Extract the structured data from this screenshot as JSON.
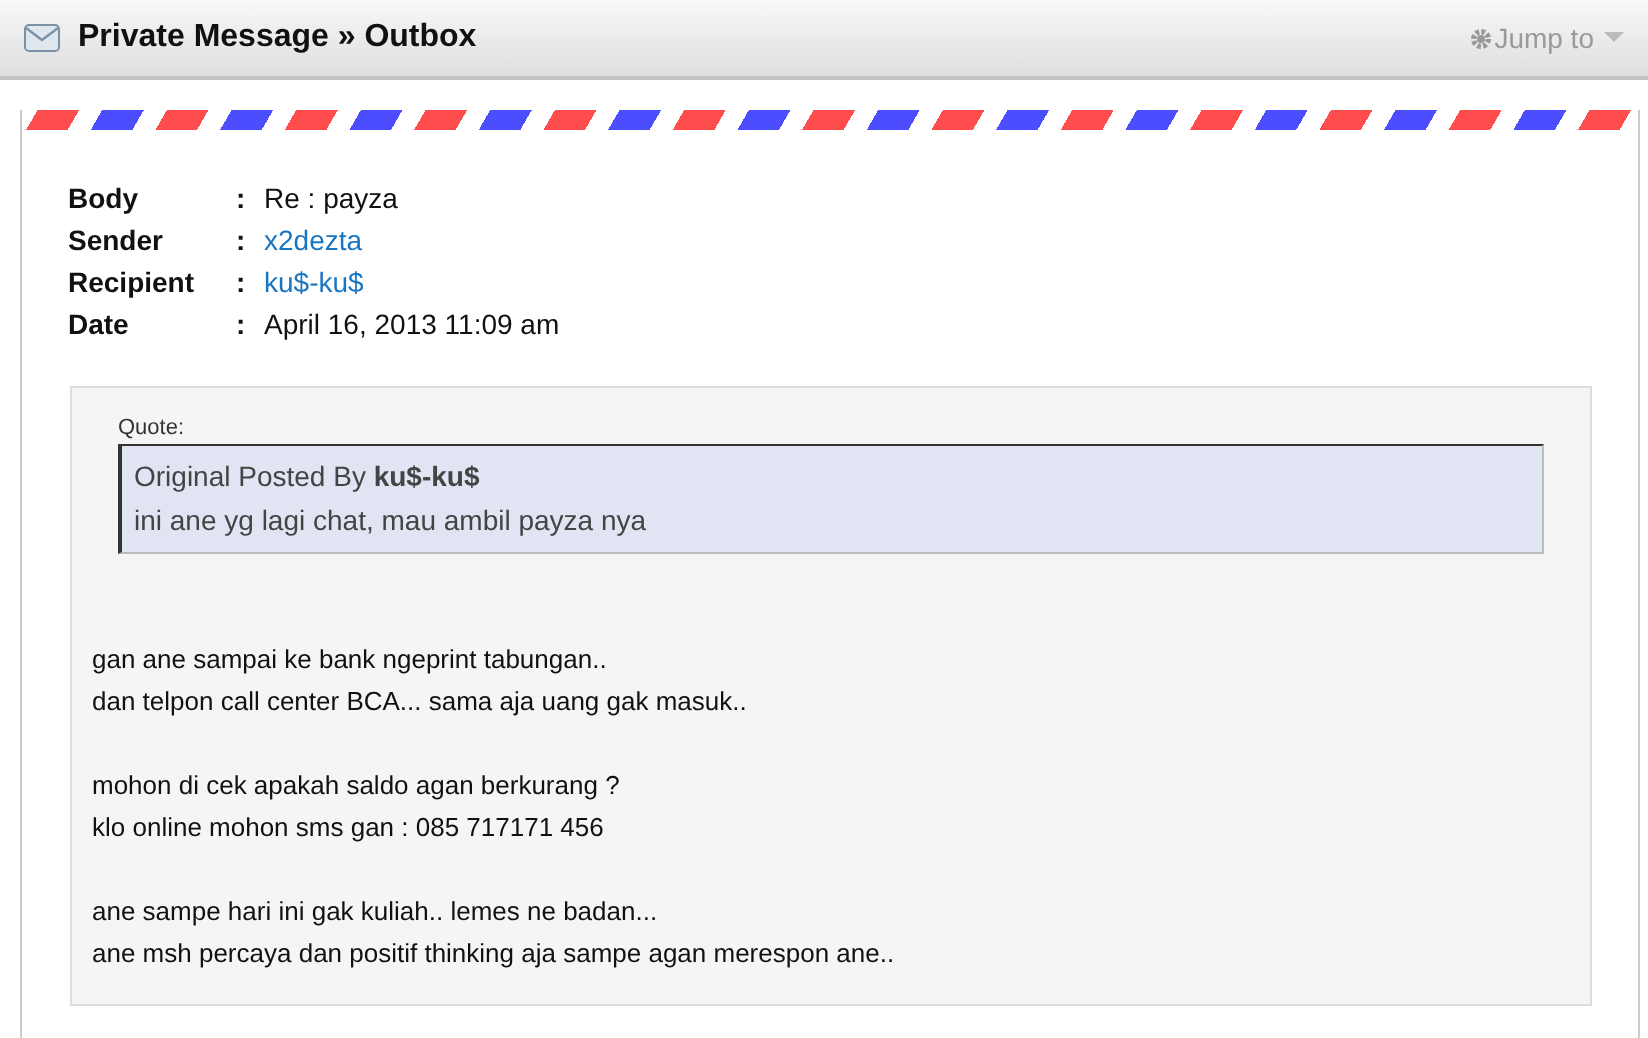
{
  "header": {
    "title": "Private Message » Outbox",
    "jump_to": "Jump to"
  },
  "fields": [
    {
      "label": "Body",
      "separator": ":",
      "value": "Re : payza",
      "kind": "text"
    },
    {
      "label": "Sender",
      "separator": ":",
      "value": "x2dezta",
      "kind": "link"
    },
    {
      "label": "Recipient",
      "separator": ":",
      "value": "ku$-ku$",
      "kind": "link"
    },
    {
      "label": "Date",
      "separator": ":",
      "value": "April 16, 2013 11:09 am",
      "kind": "text"
    }
  ],
  "quote": {
    "label": "Quote:",
    "posted_by": "Original Posted By **ku$-ku$**",
    "text": "ini ane yg lagi chat, mau ambil payza nya"
  },
  "paragraphs": [
    [
      "gan ane sampai ke bank ngeprint tabungan..",
      "dan telpon call center BCA... sama aja uang gak masuk.."
    ],
    [
      "mohon di cek apakah saldo agan berkurang ?",
      "klo online mohon sms gan : 085 717171 456"
    ],
    [
      "ane sampe hari ini gak kuliah.. lemes ne badan...",
      "ane msh percaya dan positif thinking aja sampe agan merespon ane.."
    ]
  ]
}
